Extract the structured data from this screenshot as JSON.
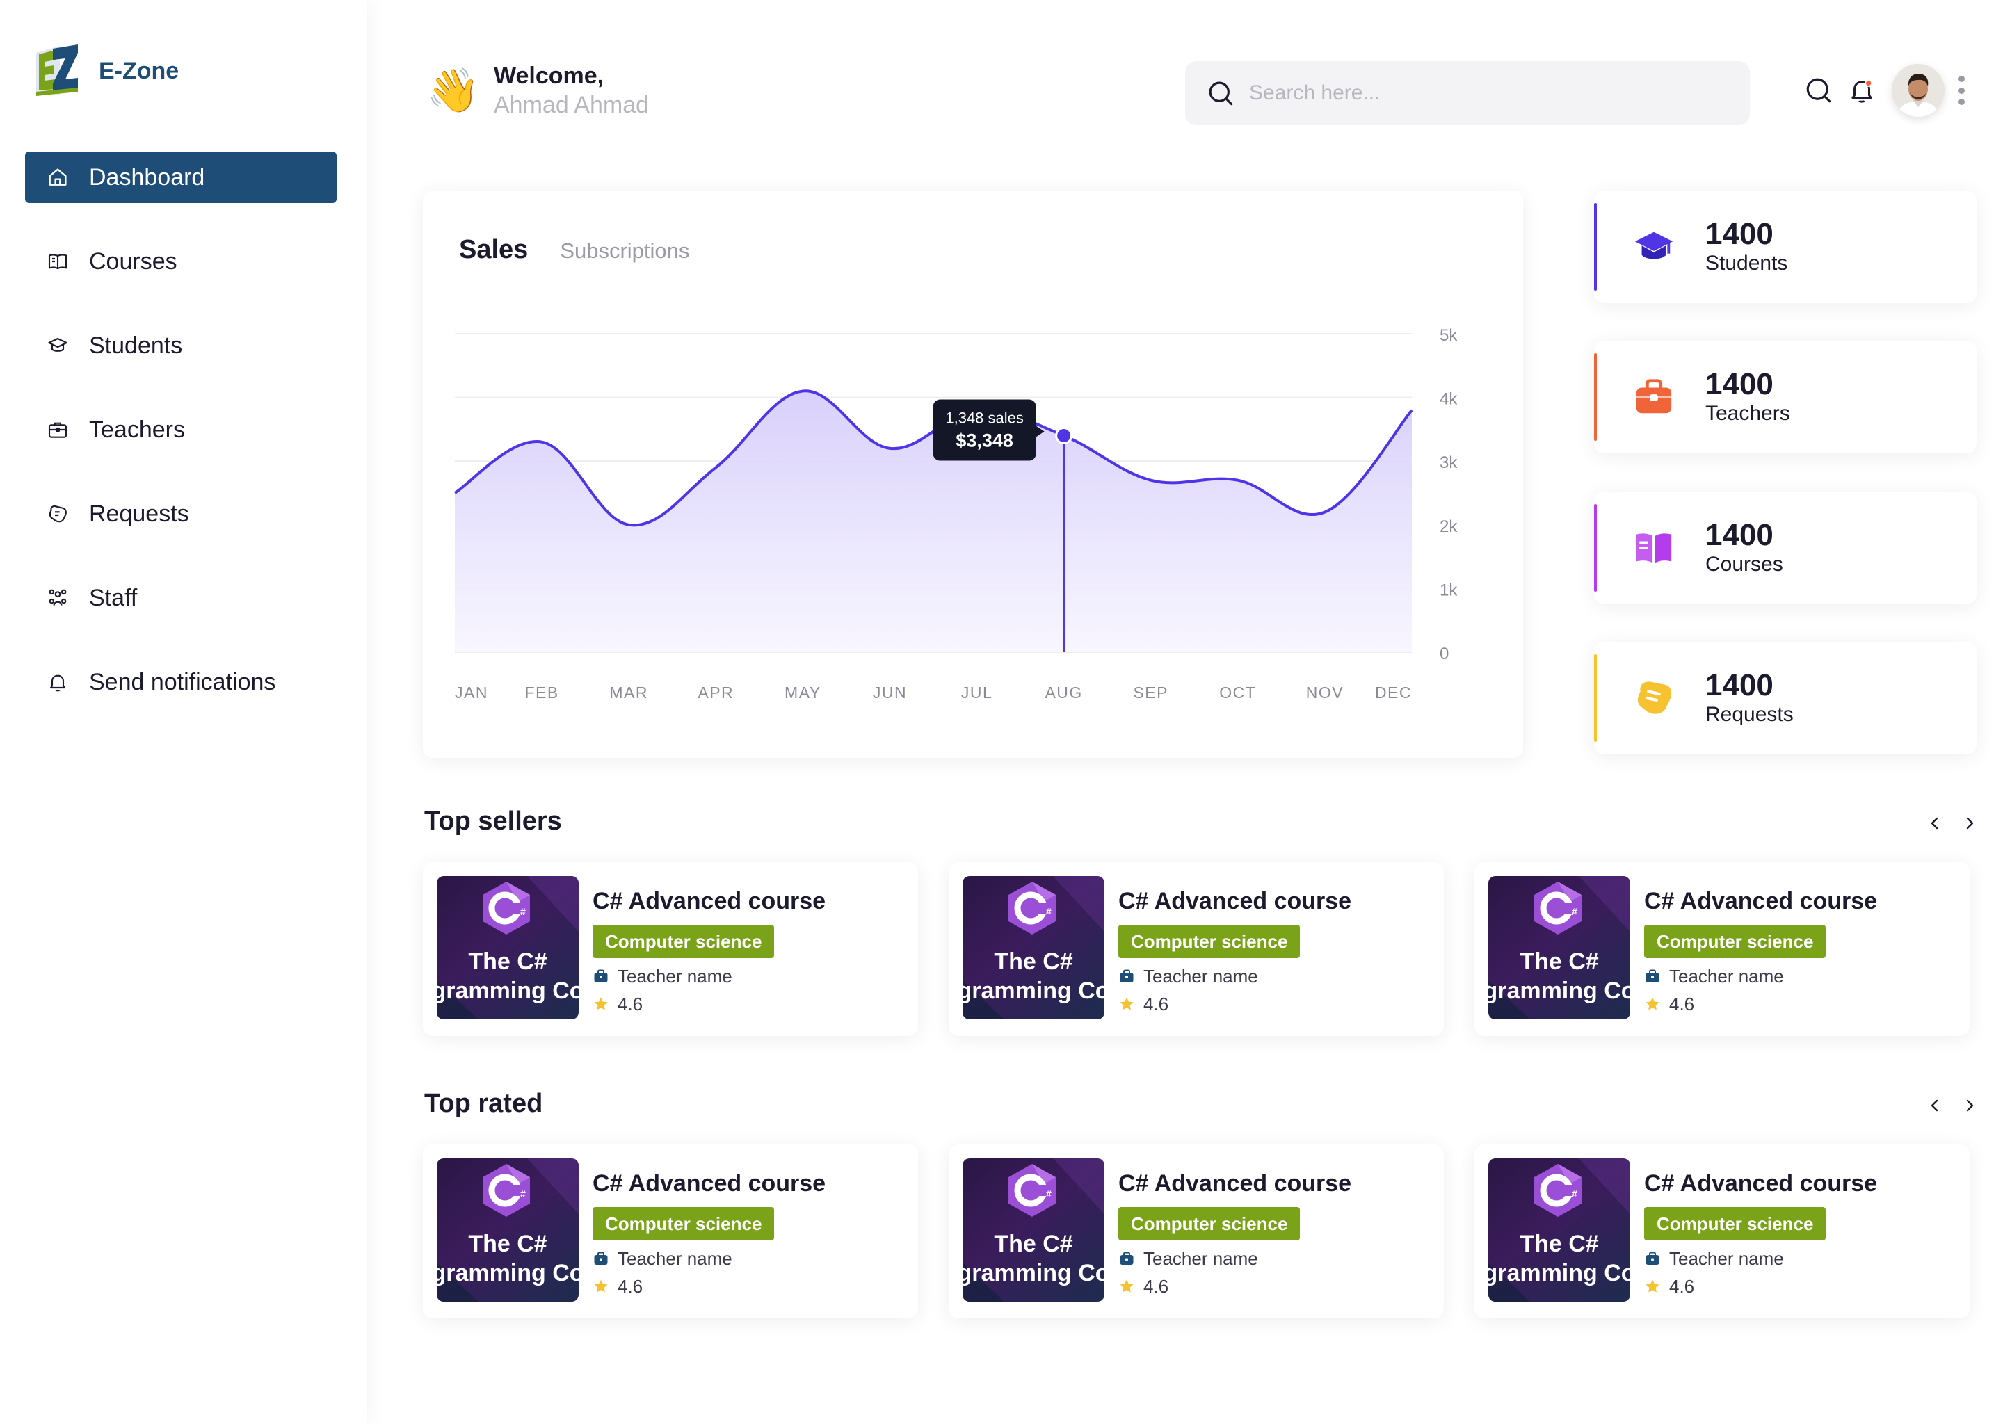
{
  "brand": {
    "name": "E-Zone"
  },
  "nav": [
    {
      "label": "Dashboard",
      "icon": "home-icon",
      "active": true
    },
    {
      "label": "Courses",
      "icon": "book-icon"
    },
    {
      "label": "Students",
      "icon": "graduation-cap-icon"
    },
    {
      "label": "Teachers",
      "icon": "briefcase-icon"
    },
    {
      "label": "Requests",
      "icon": "request-icon"
    },
    {
      "label": "Staff",
      "icon": "people-icon"
    },
    {
      "label": "Send notifications",
      "icon": "bell-icon"
    }
  ],
  "header": {
    "welcome": "Welcome,",
    "user_name": "Ahmad Ahmad",
    "search_placeholder": "Search here...",
    "wave_emoji": "👋"
  },
  "chart": {
    "tab_active": "Sales",
    "tab_inactive": "Subscriptions",
    "tooltip": {
      "sales": "1,348 sales",
      "amount": "$3,348"
    }
  },
  "chart_data": {
    "type": "area",
    "title": "Sales",
    "categories": [
      "JAN",
      "FEB",
      "MAR",
      "APR",
      "MAY",
      "JUN",
      "JUL",
      "AUG",
      "SEP",
      "OCT",
      "NOV",
      "DEC"
    ],
    "ytick_labels": [
      "0",
      "1k",
      "2k",
      "3k",
      "4k",
      "5k"
    ],
    "ylim": [
      0,
      5000
    ],
    "grid": true,
    "series": [
      {
        "values": [
          2500,
          3300,
          2000,
          2900,
          4100,
          3200,
          3800,
          3400,
          2700,
          2700,
          2200,
          3800
        ]
      }
    ],
    "highlight": {
      "x": "AUG",
      "label": "1,348 sales",
      "value": "$3,348"
    },
    "colors": {
      "line": "#4f35e6",
      "fill_top": "#d8d0fb",
      "fill_bottom": "#f7f5ff"
    }
  },
  "stats": [
    {
      "value": "1400",
      "label": "Students",
      "color": "#4f35e6",
      "icon": "graduation-cap-icon"
    },
    {
      "value": "1400",
      "label": "Teachers",
      "color": "#f0643a",
      "icon": "briefcase-icon"
    },
    {
      "value": "1400",
      "label": "Courses",
      "color": "#b53cec",
      "icon": "book-icon"
    },
    {
      "value": "1400",
      "label": "Requests",
      "color": "#f7c22f",
      "icon": "request-icon"
    }
  ],
  "top_sellers": {
    "title": "Top sellers",
    "courses": [
      {
        "title": "C# Advanced course",
        "category": "Computer science",
        "teacher": "Teacher name",
        "rating": "4.6",
        "thumb_line1": "The C#",
        "thumb_line2": "gramming Co"
      },
      {
        "title": "C# Advanced course",
        "category": "Computer science",
        "teacher": "Teacher name",
        "rating": "4.6",
        "thumb_line1": "The C#",
        "thumb_line2": "gramming Co"
      },
      {
        "title": "C# Advanced course",
        "category": "Computer science",
        "teacher": "Teacher name",
        "rating": "4.6",
        "thumb_line1": "The C#",
        "thumb_line2": "gramming Co"
      }
    ]
  },
  "top_rated": {
    "title": "Top rated",
    "courses": [
      {
        "title": "C# Advanced course",
        "category": "Computer science",
        "teacher": "Teacher name",
        "rating": "4.6",
        "thumb_line1": "The C#",
        "thumb_line2": "gramming Co"
      },
      {
        "title": "C# Advanced course",
        "category": "Computer science",
        "teacher": "Teacher name",
        "rating": "4.6",
        "thumb_line1": "The C#",
        "thumb_line2": "gramming Co"
      },
      {
        "title": "C# Advanced course",
        "category": "Computer science",
        "teacher": "Teacher name",
        "rating": "4.6",
        "thumb_line1": "The C#",
        "thumb_line2": "gramming Co"
      }
    ]
  },
  "colors": {
    "primary": "#1e4d78",
    "tag": "#7ba319",
    "star": "#f7c22f",
    "notification_dot": "#f0643a"
  }
}
